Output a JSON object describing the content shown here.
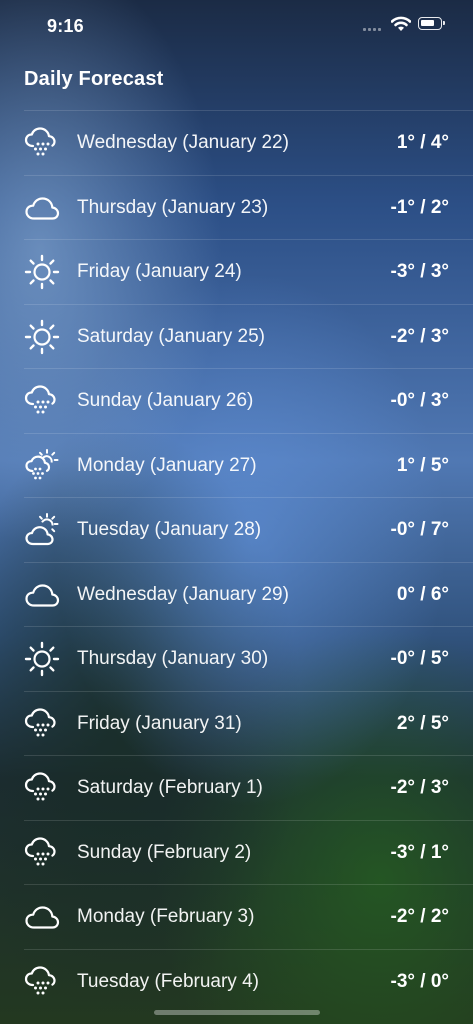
{
  "status_bar": {
    "time": "9:16",
    "signal_icon": "cellular-signal-icon",
    "wifi_icon": "wifi-icon",
    "battery_icon": "battery-icon"
  },
  "section_title": "Daily Forecast",
  "days": [
    {
      "label": "Wednesday (January 22)",
      "temp": "1° / 4°",
      "icon": "snow-icon"
    },
    {
      "label": "Thursday (January 23)",
      "temp": "-1° / 2°",
      "icon": "cloud-icon"
    },
    {
      "label": "Friday (January 24)",
      "temp": "-3° / 3°",
      "icon": "sun-icon"
    },
    {
      "label": "Saturday (January 25)",
      "temp": "-2° / 3°",
      "icon": "sun-icon"
    },
    {
      "label": "Sunday (January 26)",
      "temp": "-0° / 3°",
      "icon": "snow-icon"
    },
    {
      "label": "Monday (January 27)",
      "temp": "1° / 5°",
      "icon": "sun-snow-icon"
    },
    {
      "label": "Tuesday (January 28)",
      "temp": "-0° / 7°",
      "icon": "partly-cloudy-icon"
    },
    {
      "label": "Wednesday (January 29)",
      "temp": "0° / 6°",
      "icon": "cloud-icon"
    },
    {
      "label": "Thursday (January 30)",
      "temp": "-0° / 5°",
      "icon": "sun-icon"
    },
    {
      "label": "Friday (January 31)",
      "temp": "2° / 5°",
      "icon": "snow-icon"
    },
    {
      "label": "Saturday (February 1)",
      "temp": "-2° / 3°",
      "icon": "snow-icon"
    },
    {
      "label": "Sunday (February 2)",
      "temp": "-3° / 1°",
      "icon": "snow-icon"
    },
    {
      "label": "Monday (February 3)",
      "temp": "-2° / 2°",
      "icon": "cloud-icon"
    },
    {
      "label": "Tuesday (February 4)",
      "temp": "-3° / 0°",
      "icon": "snow-icon"
    }
  ]
}
